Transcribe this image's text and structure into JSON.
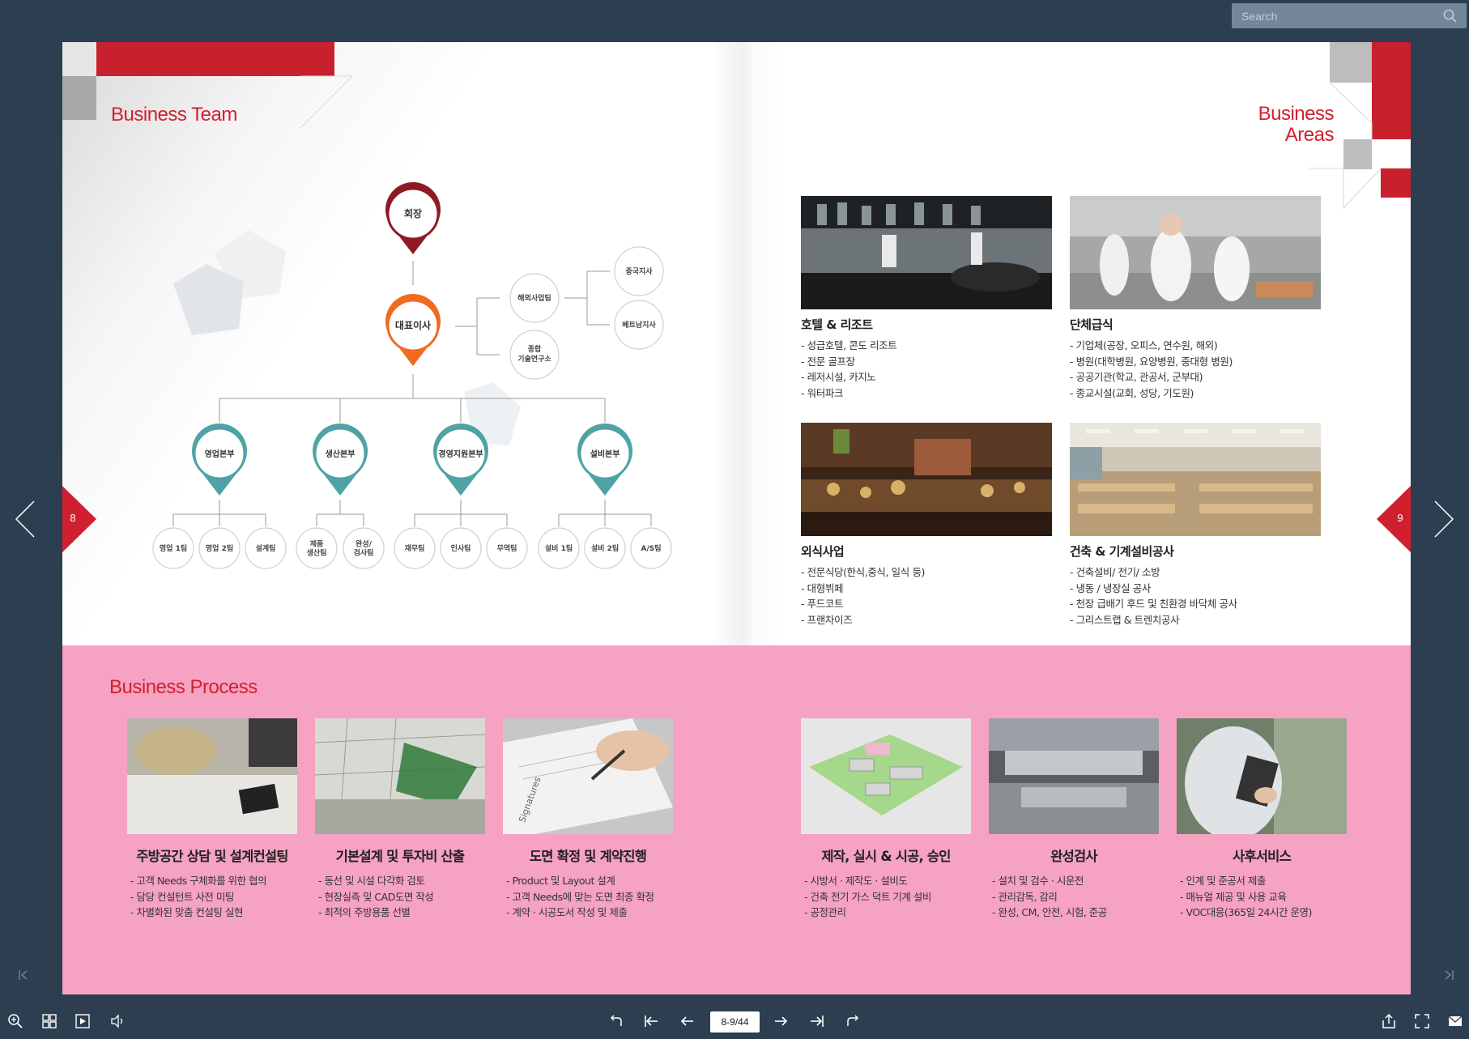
{
  "search": {
    "placeholder": "Search"
  },
  "left_page": {
    "title": "Business Team",
    "page_number": "8",
    "org": {
      "chairman": "회장",
      "ceo": "대표이사",
      "overseas_team": "해외사업팀",
      "research_line1": "종합",
      "research_line2": "기술연구소",
      "china_branch": "중국지사",
      "vietnam_branch": "베트남지사",
      "divisions": [
        {
          "label": "영업본부",
          "teams": [
            "영업 1팀",
            "영업 2팀",
            "설계팀"
          ]
        },
        {
          "label": "생산본부",
          "teams": [
            "제품\n생산팀",
            "완성/\n검사팀"
          ]
        },
        {
          "label": "경영지원본부",
          "teams": [
            "재무팀",
            "인사팀",
            "무역팀"
          ]
        },
        {
          "label": "설비본부",
          "teams": [
            "설비 1팀",
            "설비 2팀",
            "A/S팀"
          ]
        }
      ]
    }
  },
  "right_page": {
    "title_line1": "Business",
    "title_line2": "Areas",
    "page_number": "9",
    "areas": [
      {
        "title": "호텔 & 리조트",
        "items": [
          "- 성급호텔, 콘도 리조트",
          "- 전문 골프장",
          "- 레저시설, 카지노",
          "- 워터파크"
        ]
      },
      {
        "title": "단체급식",
        "items": [
          "- 기업체(공장, 오피스, 연수원, 해외)",
          "- 병원(대학병원, 요양병원, 중대형 병원)",
          "- 공공기관(학교, 관공서, 군부대)",
          "- 종교시설(교회, 성당, 기도원)"
        ]
      },
      {
        "title": "외식사업",
        "items": [
          "- 전문식당(한식,중식, 일식 등)",
          "- 대형뷔페",
          "- 푸드코트",
          "- 프랜차이즈"
        ]
      },
      {
        "title": "건축 & 기계설비공사",
        "items": [
          "- 건축설비/ 전기/ 소방",
          "- 냉동 / 냉장실 공사",
          "- 천장 급배기 후드 및 친환경 바닥체 공사",
          "- 그리스트랩 & 트렌치공사"
        ]
      }
    ]
  },
  "process": {
    "title": "Business Process",
    "steps": [
      {
        "title": "주방공간 상담 및 설계컨설팅",
        "items": [
          "- 고객 Needs 구체화를 위한 협의",
          "- 담당 컨설턴트  사전 미팅",
          "- 차별화된 맞춤 컨설팅 실현"
        ]
      },
      {
        "title": "기본설계 및 투자비 산출",
        "items": [
          "- 동선 및 시설 다각화 검토",
          "- 현장실측 및 CAD도면 작성",
          "- 최적의 주방용품 선별"
        ]
      },
      {
        "title": "도면 확정 및 계약진행",
        "items": [
          "- Product 및 Layout 설계",
          "- 고객 Needs에 맞는 도면 최종 확정",
          "- 계약 · 시공도서 작성 및 제출"
        ]
      },
      {
        "title": "제작, 실시 & 시공, 승인",
        "items": [
          "- 시방서 · 제작도 · 설비도",
          "- 건축 전기 가스 덕트 기계 설비",
          "- 공정관리"
        ]
      },
      {
        "title": "완성검사",
        "items": [
          "- 설치 및 검수 · 시운전",
          "- 관리감독, 감리",
          "- 완성, CM, 안전, 시험, 준공"
        ]
      },
      {
        "title": "사후서비스",
        "items": [
          "- 인계 및 준공서 제출",
          "- 매뉴얼 제공 및 사용 교육",
          "- VOC대응(365일 24시간 운영)"
        ]
      }
    ],
    "photo_label": "Signatures"
  },
  "toolbar": {
    "page_indicator": "8-9/44"
  },
  "colors": {
    "accent_red": "#d0202e",
    "pink_band": "#f6a2c3",
    "teal": "#4fa3a6",
    "orange": "#f26a21",
    "dark_red": "#8e1b24",
    "frame": "#2d3e50"
  }
}
